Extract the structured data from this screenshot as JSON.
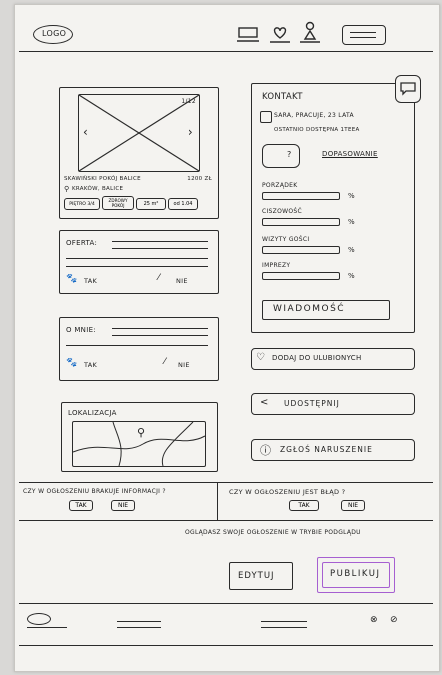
{
  "header": {
    "logo": "LOGO"
  },
  "listing": {
    "photo_counter": "1/12",
    "address": "SKAWIŃSKI POKÓJ BALICE",
    "price": "1200 ZŁ",
    "city": "KRAKÓW, BALICE",
    "tags": [
      "PIĘTRO 3/4",
      "ZDROWY POKÓJ",
      "25 m²",
      "od 1.04"
    ]
  },
  "offer": {
    "label": "OFERTA:",
    "yes": "TAK",
    "no": "NIE"
  },
  "about": {
    "label": "O MNIE:",
    "yes": "TAK",
    "no": "NIE"
  },
  "location": {
    "label": "LOKALIZACJA"
  },
  "contact": {
    "title": "KONTAKT",
    "person": "SARA, PRACUJE, 23 LATA",
    "last_seen": "OSTATNIO DOSTĘPNA 1TEEA",
    "matching": "DOPASOWANIE",
    "traits": [
      {
        "label": "PORZĄDEK",
        "pct": "%"
      },
      {
        "label": "CISZOWOŚĆ",
        "pct": "%"
      },
      {
        "label": "WIZYTY GOŚCI",
        "pct": "%"
      },
      {
        "label": "IMPREZY",
        "pct": "%"
      }
    ],
    "message_button": "WIADOMOŚĆ"
  },
  "actions": {
    "favorite": "DODAJ DO ULUBIONYCH",
    "share": "UDOSTĘPNIJ",
    "report": "ZGŁOŚ NARUSZENIE"
  },
  "survey": {
    "q1": "CZY W OGŁOSZENIU BRAKUJE INFORMACJI ?",
    "q2": "CZY W OGŁOSZENIU JEST BŁĄD ?",
    "yes": "TAK",
    "no": "NIE"
  },
  "preview": {
    "notice": "OGLĄDASZ SWOJE OGŁOSZENIE W TRYBIE PODGLĄDU",
    "edit": "EDYTUJ",
    "publish": "PUBLIKUJ",
    "publish_color": "#a65fd1"
  }
}
